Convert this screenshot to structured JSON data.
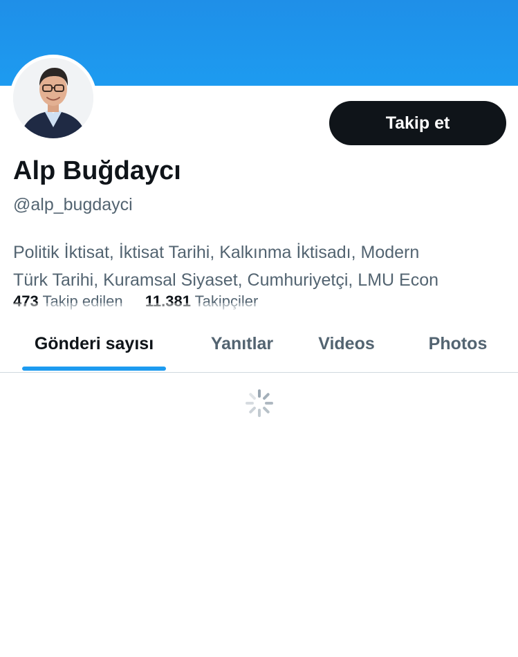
{
  "profile": {
    "name": "Alp Buğdaycı",
    "handle": "@alp_bugdayci",
    "follow_label": "Takip et",
    "bio_lines": [
      "Politik İktisat, İktisat Tarihi, Kalkınma İktisadı, Modern",
      "Türk Tarihi, Kuramsal Siyaset, Cumhuriyetçi, LMU Econ"
    ],
    "stats": {
      "following_count": "473",
      "following_label": "Takip edilen",
      "followers_count": "11.381",
      "followers_label": "Takipçiler"
    }
  },
  "tabs": [
    {
      "label": "Gönderi sayısı",
      "active": true
    },
    {
      "label": "Yanıtlar",
      "active": false
    },
    {
      "label": "Videos",
      "active": false
    },
    {
      "label": "Photos",
      "active": false
    }
  ],
  "colors": {
    "banner": "#1d9bf0",
    "accent": "#1d9bf0",
    "primary_text": "#0f1419",
    "secondary_text": "#536471",
    "button_bg": "#0f1419"
  },
  "icons": {
    "loading": "loading-spinner-icon",
    "avatar": "profile-photo"
  }
}
